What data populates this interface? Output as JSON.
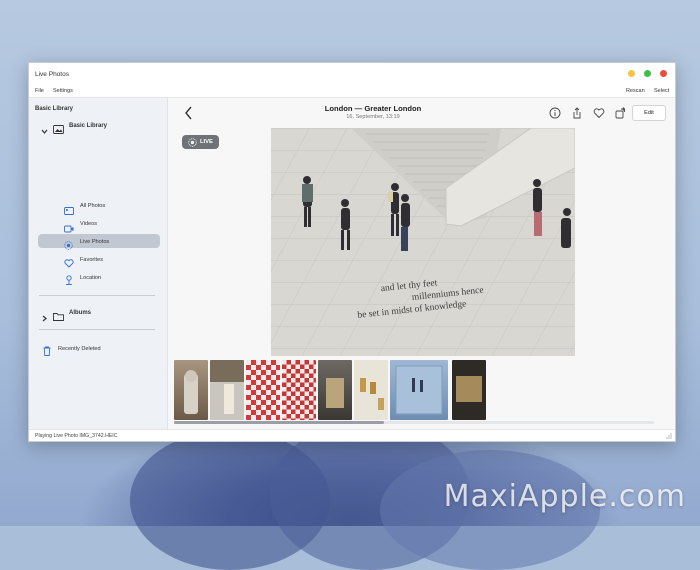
{
  "window": {
    "title": "Live Photos",
    "buttons": [
      "minimize",
      "maximize",
      "close"
    ]
  },
  "menu": {
    "file": "File",
    "settings": "Settings",
    "rescan": "Rescan",
    "select": "Select"
  },
  "sidebar": {
    "section_title": "Basic Library",
    "group_title": "Basic Library",
    "items": [
      {
        "label": "All Photos",
        "icon": "photos-icon",
        "selected": false
      },
      {
        "label": "Videos",
        "icon": "video-icon",
        "selected": false
      },
      {
        "label": "Live Photos",
        "icon": "live-photo-icon",
        "selected": true
      },
      {
        "label": "Favorites",
        "icon": "heart-icon",
        "selected": false
      },
      {
        "label": "Location",
        "icon": "location-pin-icon",
        "selected": false
      }
    ],
    "albums": "Albums",
    "recently_deleted": "Recently Deleted"
  },
  "viewer": {
    "title": "London — Greater London",
    "date": "16. September, 13:19",
    "edit": "Edit",
    "live_badge": "LIVE",
    "photo_caption_lines": [
      "and let thy feet",
      "millenniums hence",
      "be set in midst of knowledge"
    ]
  },
  "status": {
    "text": "Playing Live Photo IMG_3742.HEIC"
  },
  "watermark": "MaxiApple.com",
  "colors": {
    "selection": "#c2c8d1",
    "accent": "#2f6fd6",
    "live_badge": "#6f7378"
  }
}
